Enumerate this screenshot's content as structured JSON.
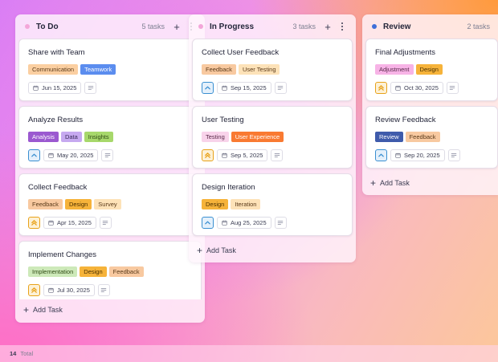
{
  "colors": {
    "tag_communication": "#fbcfa1",
    "tag_teamwork": "#5b8def",
    "tag_analysis": "#9b59d0",
    "tag_data": "#c6a9f0",
    "tag_insights": "#a7d86b",
    "tag_feedback": "#f8c9a0",
    "tag_design": "#f6b33a",
    "tag_survey": "#fde2b8",
    "tag_implementation": "#cde9b9",
    "tag_user_testing": "#fde2b8",
    "tag_testing": "#f8d3ea",
    "tag_user_experience": "#f97a32",
    "tag_iteration": "#fde2b8",
    "tag_adjustment": "#f7b3e6",
    "tag_review": "#3f5bab",
    "prio_low": "#3a8fd1",
    "prio_high": "#e8a21a"
  },
  "columns": [
    {
      "title": "To Do",
      "count_label": "5 tasks",
      "dot_color": "#f3a6d9",
      "add_label": "Add Task",
      "cards": [
        {
          "title": "Share with Team",
          "tags": [
            {
              "label": "Communication",
              "bg": "#fbcfa1",
              "fg": "#5a3a1a"
            },
            {
              "label": "Teamwork",
              "bg": "#5b8def",
              "fg": "#ffffff"
            }
          ],
          "priority": "none",
          "date": "Jun 15, 2025"
        },
        {
          "title": "Analyze Results",
          "tags": [
            {
              "label": "Analysis",
              "bg": "#9b59d0",
              "fg": "#ffffff"
            },
            {
              "label": "Data",
              "bg": "#c6a9f0",
              "fg": "#3a2a5a"
            },
            {
              "label": "Insights",
              "bg": "#a7d86b",
              "fg": "#2f4a14"
            }
          ],
          "priority": "low",
          "date": "May 20, 2025"
        },
        {
          "title": "Collect Feedback",
          "tags": [
            {
              "label": "Feedback",
              "bg": "#f8c9a0",
              "fg": "#5a3a1a"
            },
            {
              "label": "Design",
              "bg": "#f6b33a",
              "fg": "#4a2f00"
            },
            {
              "label": "Survey",
              "bg": "#fde2b8",
              "fg": "#5a3a1a"
            }
          ],
          "priority": "high",
          "date": "Apr 15, 2025"
        },
        {
          "title": "Implement Changes",
          "tags": [
            {
              "label": "Implementation",
              "bg": "#cde9b9",
              "fg": "#2f4a14"
            },
            {
              "label": "Design",
              "bg": "#f6b33a",
              "fg": "#4a2f00"
            },
            {
              "label": "Feedback",
              "bg": "#f8c9a0",
              "fg": "#5a3a1a"
            }
          ],
          "priority": "high",
          "date": "Jul 30, 2025"
        }
      ]
    },
    {
      "title": "In Progress",
      "count_label": "3 tasks",
      "dot_color": "#f3a6d9",
      "add_label": "Add Task",
      "cards": [
        {
          "title": "Collect User Feedback",
          "tags": [
            {
              "label": "Feedback",
              "bg": "#f8c9a0",
              "fg": "#5a3a1a"
            },
            {
              "label": "User Testing",
              "bg": "#fde2b8",
              "fg": "#5a3a1a"
            }
          ],
          "priority": "low",
          "date": "Sep 15, 2025"
        },
        {
          "title": "User Testing",
          "tags": [
            {
              "label": "Testing",
              "bg": "#f8d3ea",
              "fg": "#5a2a4a"
            },
            {
              "label": "User Experience",
              "bg": "#f97a32",
              "fg": "#ffffff"
            }
          ],
          "priority": "high",
          "date": "Sep 5, 2025"
        },
        {
          "title": "Design Iteration",
          "tags": [
            {
              "label": "Design",
              "bg": "#f6b33a",
              "fg": "#4a2f00"
            },
            {
              "label": "Iteration",
              "bg": "#fde2b8",
              "fg": "#5a3a1a"
            }
          ],
          "priority": "low",
          "date": "Aug 25, 2025"
        }
      ]
    },
    {
      "title": "Review",
      "count_label": "2 tasks",
      "dot_color": "#3f6fd8",
      "add_label": "Add Task",
      "cards": [
        {
          "title": "Final Adjustments",
          "tags": [
            {
              "label": "Adjustment",
              "bg": "#f7b3e6",
              "fg": "#5a2a4a"
            },
            {
              "label": "Design",
              "bg": "#f6b33a",
              "fg": "#4a2f00"
            }
          ],
          "priority": "high",
          "date": "Oct 30, 2025"
        },
        {
          "title": "Review Feedback",
          "tags": [
            {
              "label": "Review",
              "bg": "#3f5bab",
              "fg": "#ffffff"
            },
            {
              "label": "Feedback",
              "bg": "#f8c9a0",
              "fg": "#5a3a1a"
            }
          ],
          "priority": "low",
          "date": "Sep 20, 2025"
        }
      ]
    }
  ],
  "footer": {
    "total_count": "14",
    "total_label": "Total"
  }
}
